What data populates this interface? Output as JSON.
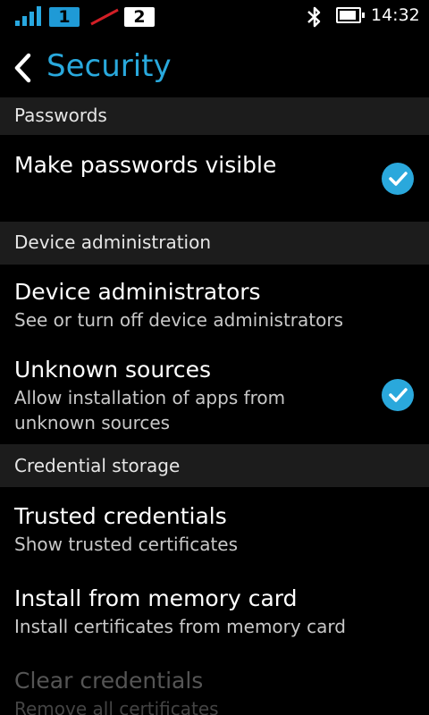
{
  "status_bar": {
    "sim1_label": "1",
    "sim2_label": "2",
    "time": "14:32",
    "icons": [
      "signal-icon",
      "sim1-icon",
      "no-signal-icon",
      "sim2-icon",
      "bluetooth-icon",
      "battery-icon"
    ],
    "accent": "#29a9dd"
  },
  "header": {
    "title": "Security"
  },
  "sections": {
    "passwords": {
      "title": "Passwords",
      "items": [
        {
          "title": "Make passwords visible",
          "checked": true
        }
      ]
    },
    "device_admin": {
      "title": "Device administration",
      "items": [
        {
          "title": "Device administrators",
          "subtitle": "See or turn off device administrators"
        },
        {
          "title": "Unknown sources",
          "subtitle_line1": "Allow installation of apps from",
          "subtitle_line2": "unknown sources",
          "checked": true
        }
      ]
    },
    "credential_storage": {
      "title": "Credential storage",
      "items": [
        {
          "title": "Trusted credentials",
          "subtitle": "Show trusted certificates"
        },
        {
          "title": "Install from memory card",
          "subtitle": "Install certificates from memory card"
        },
        {
          "title": "Clear credentials",
          "subtitle": "Remove all certificates",
          "enabled": false
        }
      ]
    }
  }
}
